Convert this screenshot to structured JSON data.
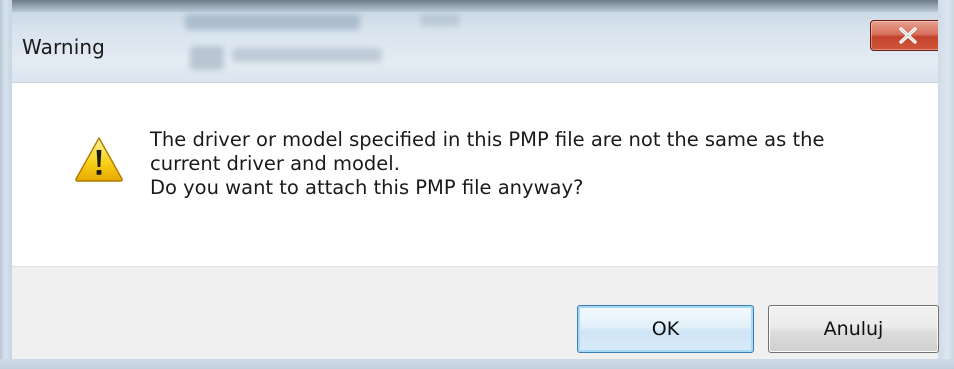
{
  "window": {
    "title": "Warning"
  },
  "title_bar": {
    "close_icon": "close-x-icon",
    "close_color": "#c4432c"
  },
  "message": {
    "icon": "warning-triangle-icon",
    "lines": [
      "The driver or model specified in this PMP file are not the same as the",
      "current driver and model.",
      "Do you want to attach this PMP file anyway?"
    ]
  },
  "buttons": {
    "ok_label": "OK",
    "cancel_label": "Anuluj"
  },
  "colors": {
    "default_button_border": "#3c7fb1",
    "footer_background": "#f0f0f0",
    "warning_yellow": "#f5c400"
  }
}
